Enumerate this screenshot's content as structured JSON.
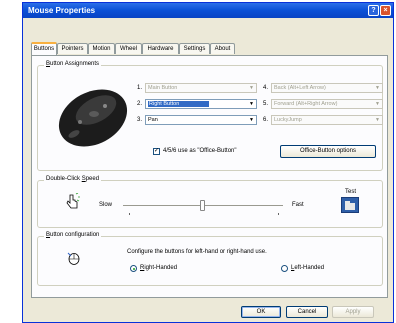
{
  "window": {
    "title": "Mouse Properties",
    "help_glyph": "?",
    "close_glyph": "×"
  },
  "tabs": [
    {
      "label": "Buttons",
      "active": true
    },
    {
      "label": "Pointers"
    },
    {
      "label": "Motion"
    },
    {
      "label": "Wheel"
    },
    {
      "label": "Hardware"
    },
    {
      "label": "Settings"
    },
    {
      "label": "About"
    }
  ],
  "button_assignments": {
    "title_pre": "B",
    "title_rest": "utton Assignments",
    "rows": [
      {
        "num": "1.",
        "value": "Main Button",
        "disabled": true
      },
      {
        "num": "2.",
        "value": "Right Button",
        "selected": true
      },
      {
        "num": "3.",
        "value": "Pan"
      },
      {
        "num": "4.",
        "value": "Back (Alt+Left Arrow)",
        "disabled": true
      },
      {
        "num": "5.",
        "value": "Forward (Alt+Right Arrow)",
        "disabled": true
      },
      {
        "num": "6.",
        "value": "LuckyJump",
        "disabled": true
      }
    ],
    "checkbox_label": "4/5/6 use as \"Office-Button\"",
    "checkbox_checked": true,
    "checkbox_glyph": "✓",
    "office_button": "Office-Button options"
  },
  "double_click": {
    "title_pre": "Double-Click ",
    "title_u": "S",
    "title_rest": "peed",
    "slow": "Slow",
    "fast": "Fast",
    "test": "Test",
    "slider_value_fraction": 0.5
  },
  "button_config": {
    "title_pre": "B",
    "title_rest": "utton configuration",
    "description": "Configure the buttons for left-hand or right-hand use.",
    "right_u": "R",
    "right_rest": "ight-Handed",
    "left_u": "L",
    "left_rest": "eft-Handed",
    "selected": "right"
  },
  "footer": {
    "ok": "OK",
    "cancel": "Cancel",
    "apply": "Apply"
  }
}
